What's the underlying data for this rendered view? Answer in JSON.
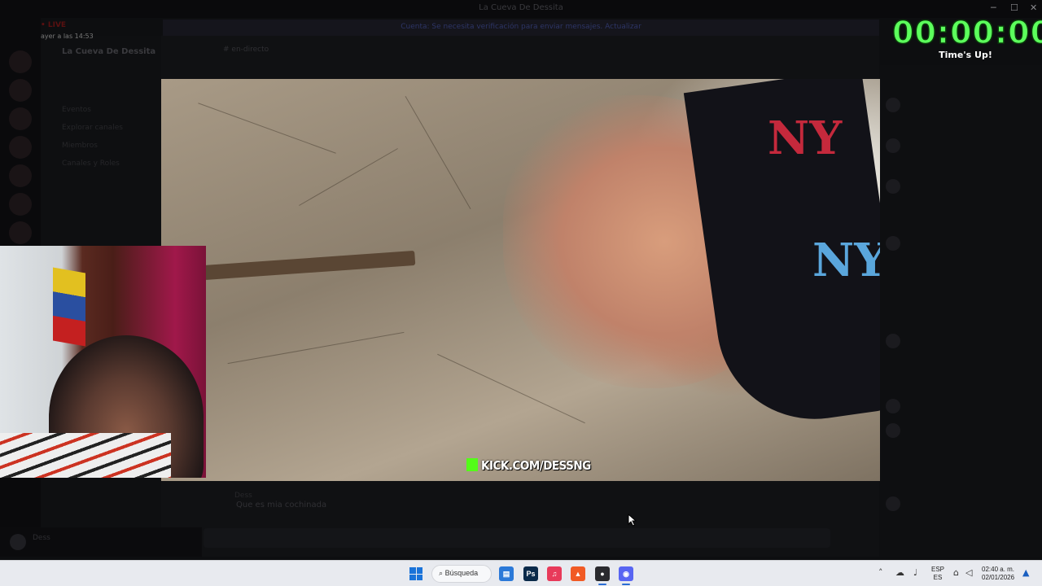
{
  "window": {
    "title": "La Cueva De Dessita",
    "minimize_icon": "─",
    "maximize_icon": "☐",
    "close_icon": "✕"
  },
  "stream_status": {
    "live_label": "• LIVE",
    "timestamp": "ayer a las 14:53"
  },
  "discord": {
    "notice": "Cuenta: Se necesita verificación para enviar mensajes. Actualizar",
    "guild_name": "La Cueva De Dessita",
    "channels": [
      "Eventos",
      "Explorar canales",
      "Miembros",
      "Canales y Roles"
    ],
    "channel_header": "# en-directo",
    "last_message_author": "Dess",
    "last_message_text": "Que es mia cochinada",
    "user_name": "Dess"
  },
  "video": {
    "watermark": "KICK.COM/DESSNG",
    "cap_logo": "NY"
  },
  "timer": {
    "display": "00:00:00",
    "status": "Time's Up!"
  },
  "taskbar": {
    "search_label": "Búsqueda",
    "search_icon": "⌕",
    "apps": [
      {
        "name": "file-explorer",
        "glyph": "▤",
        "color": "#2b79d8"
      },
      {
        "name": "photoshop",
        "glyph": "Ps",
        "color": "#0a2a4a"
      },
      {
        "name": "itunes",
        "glyph": "♫",
        "color": "#e83a5a"
      },
      {
        "name": "brave",
        "glyph": "▲",
        "color": "#f15a24"
      },
      {
        "name": "obs",
        "glyph": "●",
        "color": "#2a2a2e"
      },
      {
        "name": "discord",
        "glyph": "◉",
        "color": "#5865f2"
      }
    ],
    "language_top": "ESP",
    "language_bottom": "ES",
    "time": "02:40 a. m.",
    "date": "02/01/2026"
  }
}
